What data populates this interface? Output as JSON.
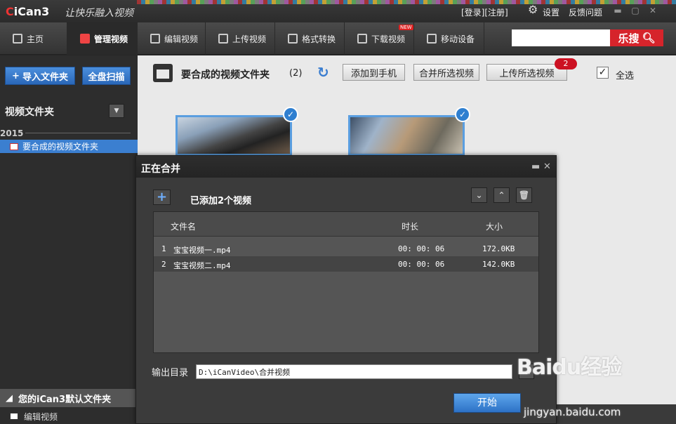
{
  "app": {
    "logo_c": "C",
    "logo_text": "iCan3",
    "slogan": "让快乐融入视频",
    "login": "[登录][注册]",
    "settings": "设置",
    "feedback": "反馈问题",
    "minimize": "▬",
    "maximize": "▢",
    "close": "✕"
  },
  "nav": {
    "items": [
      {
        "label": "主页",
        "icon": "home-icon"
      },
      {
        "label": "管理视频",
        "icon": "video-manage-icon"
      },
      {
        "label": "编辑视频",
        "icon": "edit-icon"
      },
      {
        "label": "上传视频",
        "icon": "upload-icon"
      },
      {
        "label": "格式转换",
        "icon": "convert-icon"
      },
      {
        "label": "下载视频",
        "icon": "download-icon"
      },
      {
        "label": "移动设备",
        "icon": "mobile-icon"
      }
    ],
    "new_badge": "NEW",
    "search_placeholder": "",
    "search_button": "乐搜"
  },
  "sidebar": {
    "import_btn": "导入文件夹",
    "scan_btn": "全盘扫描",
    "title": "视频文件夹",
    "year": "2015",
    "folder": "要合成的视频文件夹",
    "default_folder": "您的iCan3默认文件夹",
    "edit_item": "编辑视频"
  },
  "content": {
    "folder_title": "要合成的视频文件夹",
    "count": "(2)",
    "add_to_phone": "添加到手机",
    "merge_selected": "合并所选视频",
    "upload_selected": "上传所选视频",
    "upload_badge": "2",
    "select_all": "全选"
  },
  "modal": {
    "title": "正在合并",
    "added": "已添加2个视频",
    "columns": {
      "name": "文件名",
      "duration": "时长",
      "size": "大小"
    },
    "rows": [
      {
        "idx": "1",
        "name": "宝宝视频一.mp4",
        "duration": "00: 00: 06",
        "size": "172.0KB"
      },
      {
        "idx": "2",
        "name": "宝宝视频二.mp4",
        "duration": "00: 00: 06",
        "size": "142.0KB"
      }
    ],
    "output_label": "输出目录",
    "output_path": "D:\\iCanVideo\\合并视频",
    "start": "开始"
  },
  "watermark": {
    "brand": "Baidu经验",
    "url": "jingyan.baidu.com"
  }
}
